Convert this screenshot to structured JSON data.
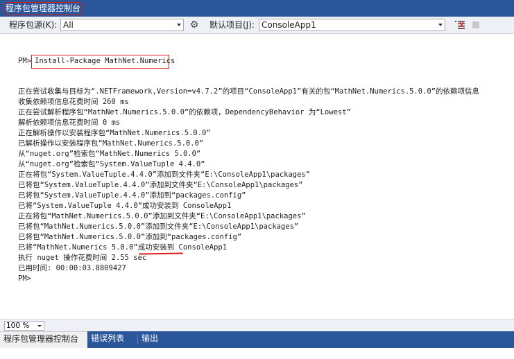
{
  "window": {
    "title": "程序包管理器控制台"
  },
  "toolbar": {
    "source_label": "程序包源(K):",
    "source_value": "All",
    "settings_icon": "gear-icon",
    "project_label": "默认项目(J):",
    "project_value": "ConsoleApp1",
    "clear_icon": "clear-console-icon",
    "stop_icon": "stop-icon"
  },
  "console": {
    "prompt": "PM>",
    "command": "Install-Package MathNet.Numerics",
    "output": [
      "正在尝试收集与目标为“.NETFramework,Version=v4.7.2”的项目“ConsoleApp1”有关的包“MathNet.Numerics.5.0.0”的依赖项信息",
      "收集依赖项信息花费时间 260 ms",
      "正在尝试解析程序包“MathNet.Numerics.5.0.0”的依赖项，DependencyBehavior 为“Lowest”",
      "解析依赖项信息花费时间 0 ms",
      "正在解析操作以安装程序包“MathNet.Numerics.5.0.0”",
      "已解析操作以安装程序包“MathNet.Numerics.5.0.0”",
      "从“nuget.org”检索包“MathNet.Numerics 5.0.0”",
      "从“nuget.org”检索包“System.ValueTuple 4.4.0”",
      "正在将包“System.ValueTuple.4.4.0”添加到文件夹“E:\\ConsoleApp1\\packages”",
      "已将包“System.ValueTuple.4.4.0”添加到文件夹“E:\\ConsoleApp1\\packages”",
      "已将包“System.ValueTuple.4.4.0”添加到“packages.config”",
      "已将“System.ValueTuple 4.4.0”成功安装到 ConsoleApp1",
      "正在将包“MathNet.Numerics.5.0.0”添加到文件夹“E:\\ConsoleApp1\\packages”",
      "已将包“MathNet.Numerics.5.0.0”添加到文件夹“E:\\ConsoleApp1\\packages”",
      "已将包“MathNet.Numerics.5.0.0”添加到“packages.config”",
      "已将“MathNet.Numerics 5.0.0”成功安装到 ConsoleApp1",
      "执行 nuget 操作花费时间 2.55 sec",
      "已用时间: 00:00:03.8809427",
      "PM>"
    ]
  },
  "status": {
    "zoom": "100 %"
  },
  "tabs": [
    {
      "label": "程序包管理器控制台"
    },
    {
      "label": "错误列表 ..."
    },
    {
      "label": "输出"
    }
  ],
  "colors": {
    "title_bar": "#2b579a",
    "highlight": "#e21a1a"
  }
}
